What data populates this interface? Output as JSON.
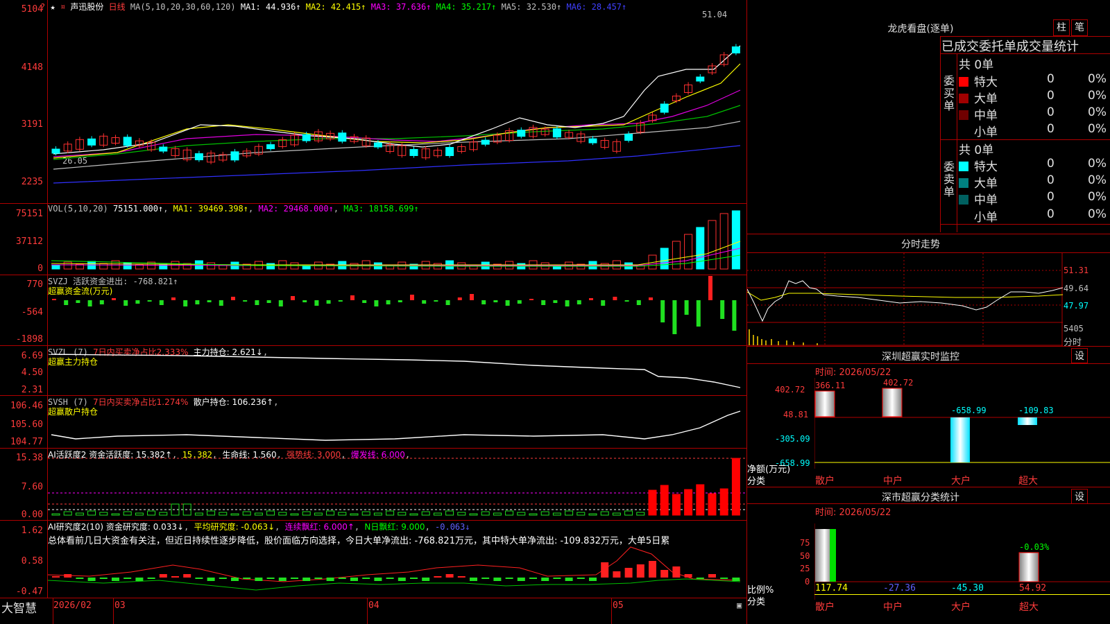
{
  "header": {
    "stock_name": "声迅股份",
    "period": "日线",
    "ma_params": "MA(5,10,20,30,60,120)",
    "ma": [
      {
        "label": "MA1: 44.936↑",
        "color": "#ffffff"
      },
      {
        "label": "MA2: 42.415↑",
        "color": "#ffff00"
      },
      {
        "label": "MA3: 37.636↑",
        "color": "#ff00ff"
      },
      {
        "label": "MA4: 35.217↑",
        "color": "#00ff00"
      },
      {
        "label": "MA5: 32.530↑",
        "color": "#c0c0c0"
      },
      {
        "label": "MA6: 28.457↑",
        "color": "#4040ff"
      }
    ]
  },
  "price_axis": [
    "5104",
    "4148",
    "3191",
    "2235"
  ],
  "price_annot_high": "51.04",
  "price_annot_low": "26.05",
  "vol": {
    "title": "VOL(5,10,20)",
    "value": "75151.000↑",
    "ma1": "MA1: 39469.398↑",
    "ma2": "MA2: 29468.000↑",
    "ma3": "MA3: 18158.699↑",
    "axis": [
      "75151",
      "37112",
      "0"
    ]
  },
  "svzj": {
    "title": "SVZJ  活跃资金进出: -768.821↑",
    "subtitle": "超赢资金流(万元)",
    "axis": [
      "770",
      "-564",
      "-1898"
    ]
  },
  "svzl": {
    "title": "SVZL (7)",
    "ratio": "7日内买卖净占比2.333%",
    "hold": "主力持仓: 2.621↓",
    "subtitle": "超赢主力持仓",
    "axis": [
      "6.69",
      "4.50",
      "2.31"
    ]
  },
  "svsh": {
    "title": "SVSH (7)",
    "ratio": "7日内买卖净占比1.274%",
    "hold": "散户持仓: 106.236↑",
    "subtitle": "超赢散户持仓",
    "axis": [
      "106.46",
      "105.60",
      "104.77"
    ]
  },
  "ai1": {
    "title": "AI活跃度2 资金活跃度: 15.382↑",
    "v2": "15.382",
    "life": "生命线: 1.560",
    "strong": "强势线: 3.000",
    "burst": "爆发线: 6.000",
    "axis": [
      "15.38",
      "7.60",
      "0.00"
    ]
  },
  "ai2": {
    "title": "AI研究度2(10) 资金研究度: 0.033↓",
    "avg": "平均研究度: -0.063↓",
    "lianxu": "连续飘红: 6.000↑",
    "nri": "N日飘红: 9.000",
    "last": "-0.063↓",
    "comment": "总体看前几日大资金有关注，但近日持续性逐步降低，股价面临方向选择，今日大单净流出: -768.821万元，其中特大单净流出: -109.832万元，大单5日累",
    "axis": [
      "1.62",
      "0.58",
      "-0.47"
    ]
  },
  "xaxis": {
    "brand": "大智慧",
    "labels": [
      "2026/02",
      "03",
      "04",
      "05"
    ]
  },
  "lhb": {
    "title": "龙虎看盘(逐单)",
    "btn1": "柱",
    "btn2": "笔",
    "tabs": "已成交委托单成交量统计",
    "buy_label": "委买单",
    "sell_label": "委卖单",
    "buy_total": "共 0单",
    "sell_total": "共 0单",
    "buy_rows": [
      {
        "name": "特大",
        "count": "0",
        "pct": "0%",
        "color": "#ff0000"
      },
      {
        "name": "大单",
        "count": "0",
        "pct": "0%",
        "color": "#a00000"
      },
      {
        "name": "中单",
        "count": "0",
        "pct": "0%",
        "color": "#700000"
      },
      {
        "name": "小单",
        "count": "0",
        "pct": "0%",
        "color": ""
      }
    ],
    "sell_rows": [
      {
        "name": "特大",
        "count": "0",
        "pct": "0%",
        "color": "#00ffff"
      },
      {
        "name": "大单",
        "count": "0",
        "pct": "0%",
        "color": "#008080"
      },
      {
        "name": "中单",
        "count": "0",
        "pct": "0%",
        "color": "#006060"
      },
      {
        "name": "小单",
        "count": "0",
        "pct": "0%",
        "color": ""
      }
    ]
  },
  "intraday": {
    "title": "分时走势",
    "axis": [
      "51.31",
      "49.64",
      "47.97"
    ],
    "vol_axis": "5405",
    "vol_label": "分时"
  },
  "sz_monitor": {
    "title": "深圳超赢实时监控",
    "btn": "设",
    "time": "时间: 2026/05/22",
    "axis": [
      "402.72",
      "48.81",
      "-305.09",
      "-658.99"
    ],
    "bar_labels": [
      "366.11",
      "402.72",
      "-658.99",
      "-109.83"
    ],
    "unit_label": "净额(万元)",
    "cat_label": "分类",
    "cats": [
      "散户",
      "中户",
      "大户",
      "超大"
    ]
  },
  "sz_stats": {
    "title": "深市超赢分类统计",
    "btn": "设",
    "time": "时间: 2026/05/22",
    "axis": [
      "75",
      "50",
      "25",
      "0"
    ],
    "top_label": "-0.03%",
    "ratio_label": "比例%",
    "cat_label": "分类",
    "values": [
      "117.74",
      "-27.36",
      "-45.30",
      "54.92"
    ],
    "cats": [
      "散户",
      "中户",
      "大户",
      "超大"
    ]
  }
}
